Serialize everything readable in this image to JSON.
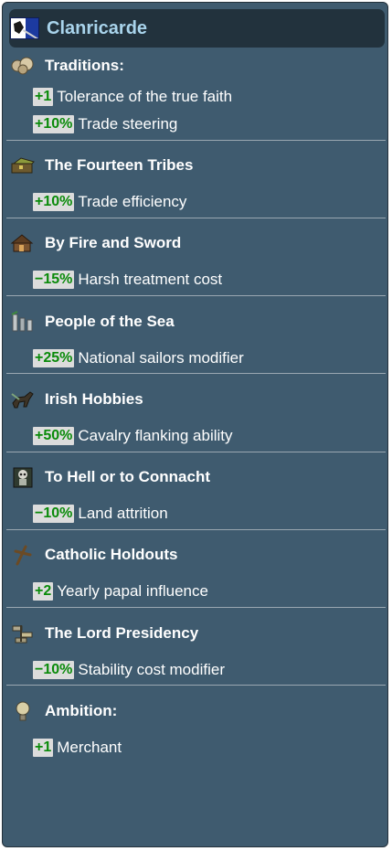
{
  "header": {
    "title": "Clanricarde"
  },
  "sections": [
    {
      "title": "Traditions:",
      "icon": "traditions-icon",
      "effects": [
        {
          "value": "+1",
          "label": "Tolerance of the true faith"
        },
        {
          "value": "+10%",
          "label": "Trade steering"
        }
      ]
    },
    {
      "title": "The Fourteen Tribes",
      "icon": "trade-chest-icon",
      "effects": [
        {
          "value": "+10%",
          "label": "Trade efficiency"
        }
      ]
    },
    {
      "title": "By Fire and Sword",
      "icon": "burning-house-icon",
      "effects": [
        {
          "value": "−15%",
          "label": "Harsh treatment cost"
        }
      ]
    },
    {
      "title": "People of the Sea",
      "icon": "sailors-icon",
      "effects": [
        {
          "value": "+25%",
          "label": "National sailors modifier"
        }
      ]
    },
    {
      "title": "Irish Hobbies",
      "icon": "cavalry-icon",
      "effects": [
        {
          "value": "+50%",
          "label": "Cavalry flanking ability"
        }
      ]
    },
    {
      "title": "To Hell or to Connacht",
      "icon": "skull-attrition-icon",
      "effects": [
        {
          "value": "−10%",
          "label": "Land attrition"
        }
      ]
    },
    {
      "title": "Catholic Holdouts",
      "icon": "cross-icon",
      "effects": [
        {
          "value": "+2",
          "label": "Yearly papal influence"
        }
      ]
    },
    {
      "title": "The Lord Presidency",
      "icon": "stability-coins-icon",
      "effects": [
        {
          "value": "−10%",
          "label": "Stability cost modifier"
        }
      ]
    },
    {
      "title": "Ambition:",
      "icon": "lightbulb-icon",
      "effects": [
        {
          "value": "+1",
          "label": "Merchant"
        }
      ]
    }
  ],
  "colors": {
    "panel": "#3f5b6f",
    "header": "#22323d",
    "title": "#a9d4ec",
    "badge_bg": "#dcdcdc",
    "badge_text": "#0a8a0a"
  }
}
